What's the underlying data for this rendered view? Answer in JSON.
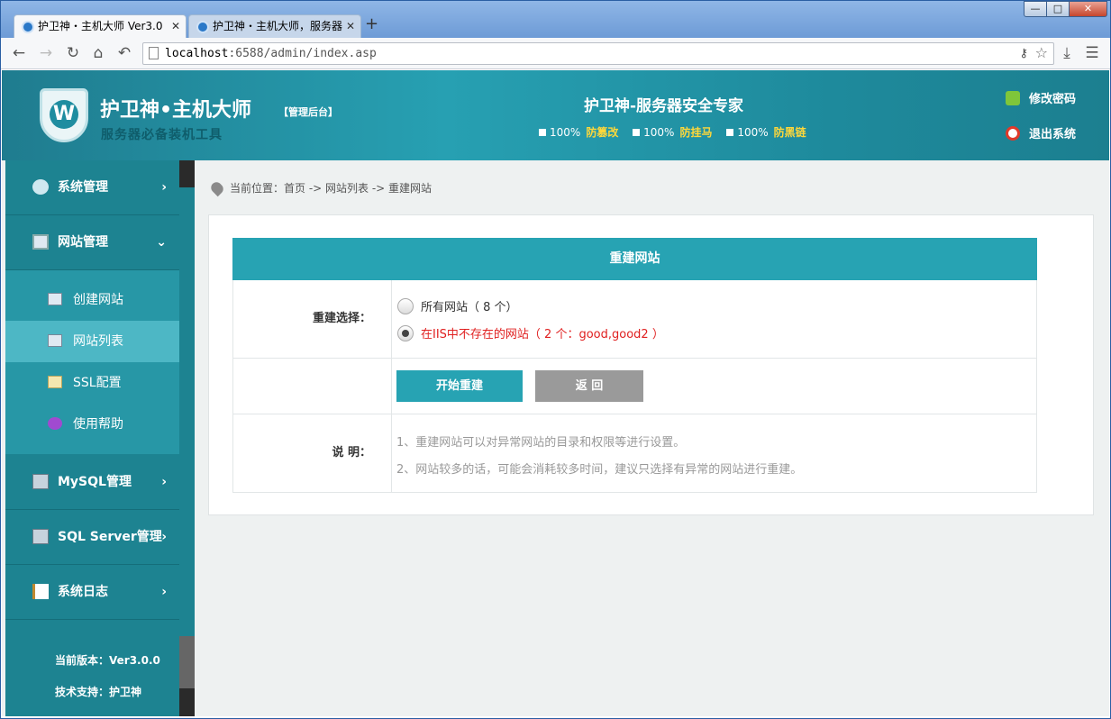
{
  "browser": {
    "tabs": [
      {
        "label": "护卫神・主机大师 Ver3.0",
        "close": "✕"
      },
      {
        "label": "护卫神・主机大师，服务器",
        "close": "✕"
      }
    ],
    "new_tab": "+",
    "window_controls": {
      "minimize": "—",
      "maximize": "□",
      "close": "✕"
    },
    "url_host": "localhost",
    "url_rest": ":6588/admin/index.asp",
    "nav": {
      "back": "←",
      "forward": "→",
      "reload": "↻",
      "home": "⌂",
      "undo": "↶"
    },
    "tools": {
      "download": "⤓",
      "menu": "☰",
      "key": "⚷",
      "star": "☆"
    }
  },
  "header": {
    "logo_letter": "W",
    "title": "护卫神•主机大师",
    "tag": "【管理后台】",
    "subtitle": "服务器必备装机工具",
    "slogan": "护卫神-服务器安全专家",
    "guards": [
      {
        "pct": "100%",
        "name": "防篡改"
      },
      {
        "pct": "100%",
        "name": "防挂马"
      },
      {
        "pct": "100%",
        "name": "防黑链"
      }
    ],
    "change_password": "修改密码",
    "logout": "退出系统",
    "colors": {
      "primary": "#27a3b3",
      "highlight": "#ffd83a"
    }
  },
  "sidebar": {
    "items": [
      {
        "label": "系统管理",
        "arrow": "›"
      },
      {
        "label": "网站管理",
        "arrow": "⌄"
      },
      {
        "label": "MySQL管理",
        "arrow": "›"
      },
      {
        "label": "SQL Server管理",
        "arrow": "›"
      },
      {
        "label": "系统日志",
        "arrow": "›"
      }
    ],
    "subitems": [
      {
        "label": "创建网站"
      },
      {
        "label": "网站列表"
      },
      {
        "label": "SSL配置"
      },
      {
        "label": "使用帮助"
      }
    ],
    "version": "当前版本：Ver3.0.0",
    "support": "技术支持：护卫神"
  },
  "main": {
    "breadcrumb": "当前位置：首页 -> 网站列表 -> 重建网站",
    "panel_title": "重建网站",
    "rebuild_label": "重建选择：",
    "options": [
      {
        "label": "所有网站（ 8 个）",
        "selected": false
      },
      {
        "label": "在IIS中不存在的网站（ 2 个：good,good2 ）",
        "selected": true
      }
    ],
    "start_button": "开始重建",
    "back_button": "返 回",
    "notes_label": "说 明：",
    "notes": [
      "1、重建网站可以对异常网站的目录和权限等进行设置。",
      "2、网站较多的话，可能会消耗较多时间，建议只选择有异常的网站进行重建。"
    ]
  }
}
